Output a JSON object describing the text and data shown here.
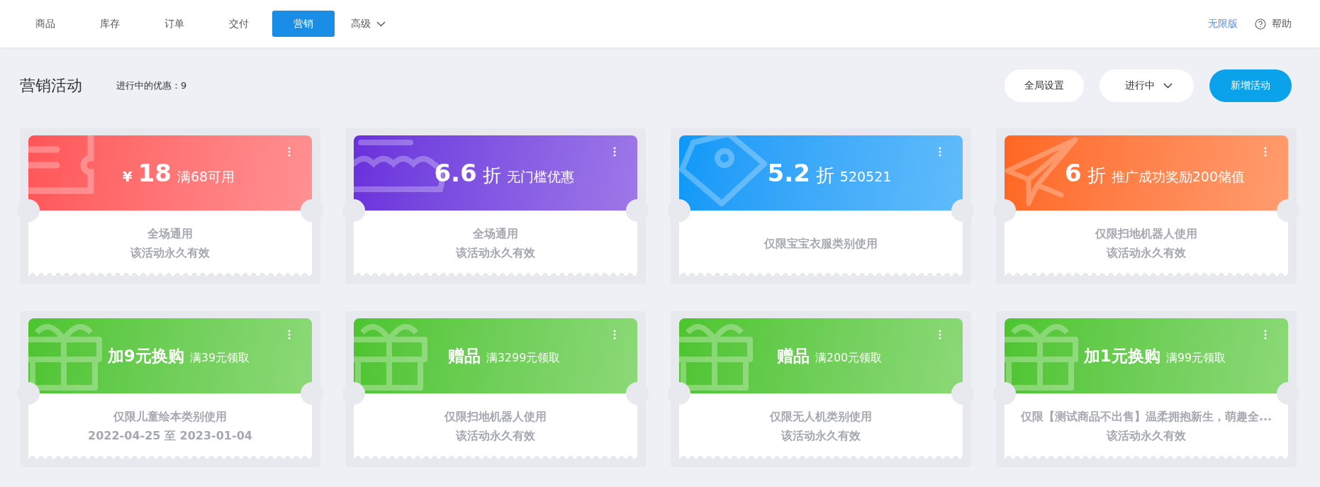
{
  "nav": {
    "tabs": [
      {
        "label": "商品",
        "selected": false,
        "has_menu": false
      },
      {
        "label": "库存",
        "selected": false,
        "has_menu": false
      },
      {
        "label": "订单",
        "selected": false,
        "has_menu": false
      },
      {
        "label": "交付",
        "selected": false,
        "has_menu": false
      },
      {
        "label": "营销",
        "selected": true,
        "has_menu": false
      },
      {
        "label": "高级",
        "selected": false,
        "has_menu": true
      }
    ],
    "plan_link": "无限版",
    "help": "帮助"
  },
  "toolbar": {
    "title": "营销活动",
    "summary": "进行中的优惠：9",
    "buttons": [
      {
        "label": "全局设置",
        "kind": "plain"
      },
      {
        "label": "进行中",
        "kind": "dropdown"
      },
      {
        "label": "新增活动",
        "kind": "primary"
      }
    ]
  },
  "campaigns": [
    {
      "kind": "cash",
      "color": "#ff5558",
      "currency": "¥",
      "value": "18",
      "condition": "满68可用",
      "lines": [
        "全场通用",
        "该活动永久有效"
      ]
    },
    {
      "kind": "discount",
      "color": "#6a2fdc",
      "value": "6.6",
      "unit": "折",
      "condition": "无门槛优惠",
      "lines": [
        "全场通用",
        "该活动永久有效"
      ]
    },
    {
      "kind": "discount",
      "color": "#0a98f8",
      "value": "5.2",
      "unit": "折",
      "condition": "520521",
      "lines": [
        "仅限宝宝衣服类别使用"
      ]
    },
    {
      "kind": "discount",
      "color": "#ff6720",
      "value": "6",
      "unit": "折",
      "condition": "推广成功奖励200储值",
      "lines": [
        "仅限扫地机器人使用",
        "该活动永久有效"
      ]
    },
    {
      "kind": "gift",
      "color": "#4dc42e",
      "value": "加9元换购",
      "condition": "满39元领取",
      "lines": [
        "仅限儿童绘本类别使用",
        "2022-04-25 至 2023-01-04"
      ]
    },
    {
      "kind": "gift",
      "color": "#4dc42e",
      "value": "赠品",
      "condition": "满3299元领取",
      "lines": [
        "仅限扫地机器人使用",
        "该活动永久有效"
      ]
    },
    {
      "kind": "gift",
      "color": "#4dc42e",
      "value": "赠品",
      "condition": "满200元领取",
      "lines": [
        "仅限无人机类别使用",
        "该活动永久有效"
      ]
    },
    {
      "kind": "gift",
      "color": "#4dc42e",
      "value": "加1元换购",
      "condition": "满99元领取",
      "lines": [
        "仅限【测试商品不出售】温柔拥抱新生，萌趣全...",
        "该活动永久有效"
      ]
    }
  ]
}
